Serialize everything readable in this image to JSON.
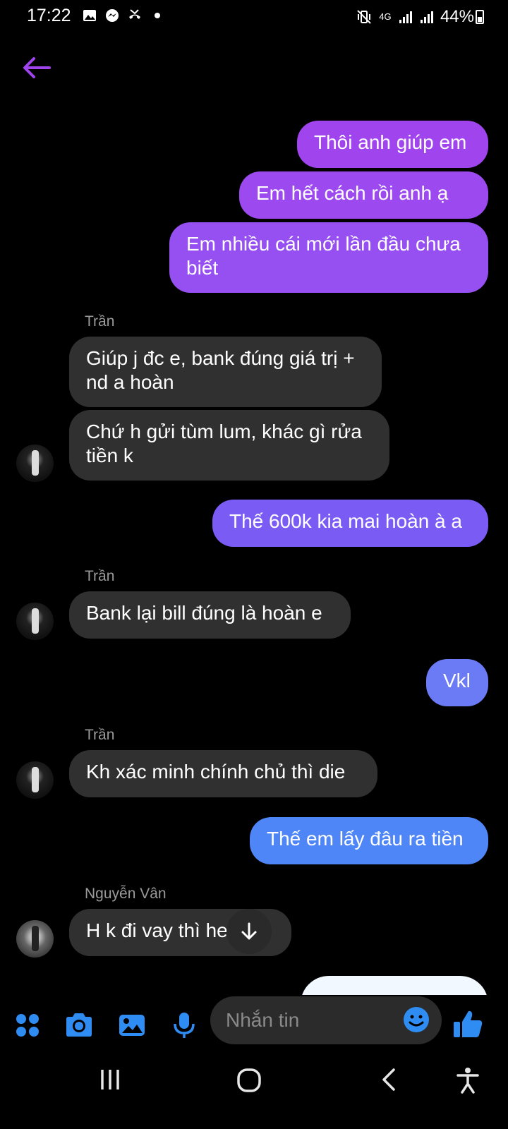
{
  "status_bar": {
    "time": "17:22",
    "network": "4G",
    "battery": "44%"
  },
  "header": {
    "back_icon": "arrow-left-icon"
  },
  "messages": [
    {
      "side": "out",
      "text": "Thôi anh giúp em"
    },
    {
      "side": "out",
      "text": "Em hết cách rồi anh ạ"
    },
    {
      "side": "out",
      "text": "Em nhiều cái mới lần đầu chưa biết"
    },
    {
      "side": "in",
      "sender": "Trần",
      "text": "Giúp j đc e, bank đúng giá trị + nd a hoàn"
    },
    {
      "side": "in",
      "text": "Chứ h gửi tùm lum, khác gì rửa tiền k"
    },
    {
      "side": "out",
      "text": "Thế 600k kia mai hoàn à a"
    },
    {
      "side": "in",
      "sender": "Trần",
      "text": "Bank lại bill đúng là hoàn e"
    },
    {
      "side": "out",
      "text": "Vkl"
    },
    {
      "side": "in",
      "sender": "Trần",
      "text": "Kh xác minh chính chủ thì die"
    },
    {
      "side": "out",
      "text": "Thế em lấy đâu ra tiền"
    },
    {
      "side": "in",
      "sender": "Nguyễn Vân",
      "text": "H k đi vay thì hetcmu"
    }
  ],
  "composer": {
    "placeholder": "Nhắn tin"
  },
  "colors": {
    "out_top": "#a044ee",
    "out_mid": "#7a5cf5",
    "out_low": "#6b7bf5",
    "out_bottom": "#4f86f7",
    "in_bubble": "#303030",
    "accent_blue": "#2f8cf3"
  }
}
